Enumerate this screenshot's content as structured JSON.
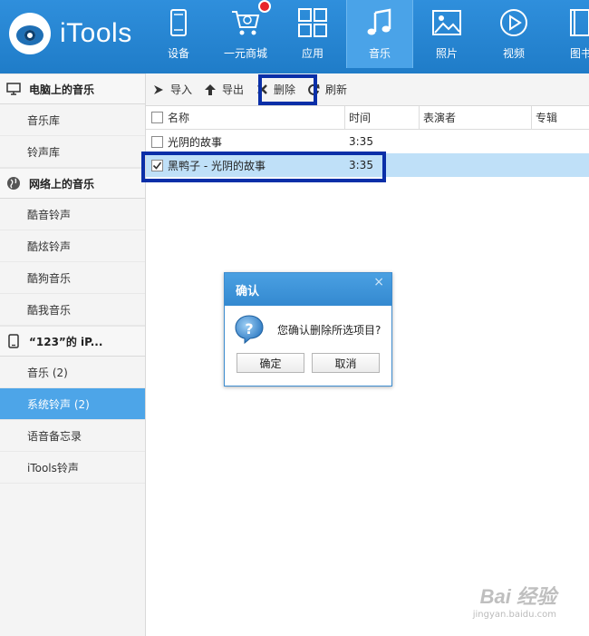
{
  "app": {
    "name": "iTools"
  },
  "nav": [
    {
      "label": "设备",
      "icon": "phone-icon"
    },
    {
      "label": "一元商城",
      "icon": "cart-icon"
    },
    {
      "label": "应用",
      "icon": "apps-grid-icon"
    },
    {
      "label": "音乐",
      "icon": "music-note-icon",
      "active": true
    },
    {
      "label": "照片",
      "icon": "photo-icon"
    },
    {
      "label": "视频",
      "icon": "play-icon"
    },
    {
      "label": "图书",
      "icon": "book-icon"
    }
  ],
  "sidebar": {
    "pc": {
      "title": "电脑上的音乐",
      "items": [
        {
          "label": "音乐库"
        },
        {
          "label": "铃声库"
        }
      ]
    },
    "net": {
      "title": "网络上的音乐",
      "items": [
        {
          "label": "酷音铃声"
        },
        {
          "label": "酷炫铃声"
        },
        {
          "label": "酷狗音乐"
        },
        {
          "label": "酷我音乐"
        }
      ]
    },
    "device": {
      "title": "“123”的 iP...",
      "items": [
        {
          "label": "音乐 (2)"
        },
        {
          "label": "系统铃声 (2)",
          "active": true
        },
        {
          "label": "语音备忘录"
        },
        {
          "label": "iTools铃声"
        }
      ]
    }
  },
  "toolbar": {
    "import_label": "导入",
    "export_label": "导出",
    "delete_label": "删除",
    "refresh_label": "刷新"
  },
  "table": {
    "headers": {
      "name": "名称",
      "time": "时间",
      "artist": "表演者",
      "album": "专辑"
    },
    "rows": [
      {
        "name": "光阴的故事",
        "time": "3:35",
        "checked": false,
        "selected": false
      },
      {
        "name": "黑鸭子 - 光阴的故事",
        "time": "3:35",
        "checked": true,
        "selected": true
      }
    ]
  },
  "dialog": {
    "title": "确认",
    "close": "×",
    "message": "您确认删除所选项目?",
    "ok_label": "确定",
    "cancel_label": "取消"
  },
  "watermark": {
    "main": "Bai 经验",
    "sub": "jingyan.baidu.com"
  },
  "colors": {
    "header": "#1f7cc8",
    "active": "#4da5e8",
    "selected_row": "#bfe0f8",
    "highlight_box": "#0a2fa8",
    "badge": "#e8242b"
  }
}
